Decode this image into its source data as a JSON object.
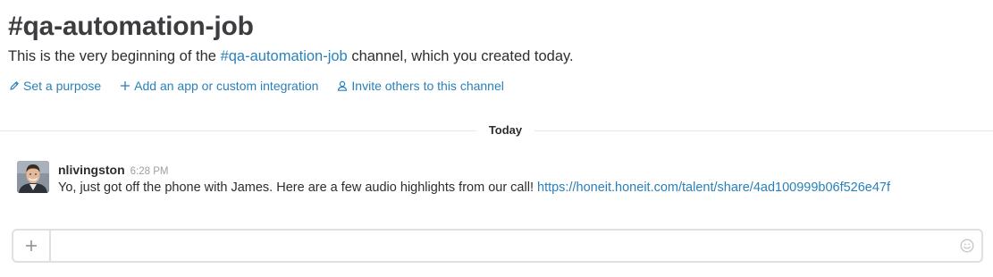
{
  "channel": {
    "title": "#qa-automation-job",
    "intro_prefix": "This is the very beginning of the ",
    "intro_link": "#qa-automation-job",
    "intro_suffix": " channel, which you created today."
  },
  "actions": [
    {
      "label": "Set a purpose",
      "icon": "pencil-icon"
    },
    {
      "label": "Add an app or custom integration",
      "icon": "plus-icon"
    },
    {
      "label": "Invite others to this channel",
      "icon": "user-icon"
    }
  ],
  "divider": {
    "label": "Today"
  },
  "messages": [
    {
      "sender": "nlivingston",
      "time": "6:28 PM",
      "text": "Yo, just got off the phone with James. Here are a few audio highlights from our call! ",
      "link": "https://honeit.honeit.com/talent/share/4ad100999b06f526e47f"
    }
  ],
  "composer": {
    "value": "",
    "placeholder": ""
  },
  "colors": {
    "link": "#2a80b9",
    "text": "#2c2d30",
    "title": "#3d3c40",
    "timestamp": "#9e9ea6",
    "border": "#e0e0e0"
  }
}
